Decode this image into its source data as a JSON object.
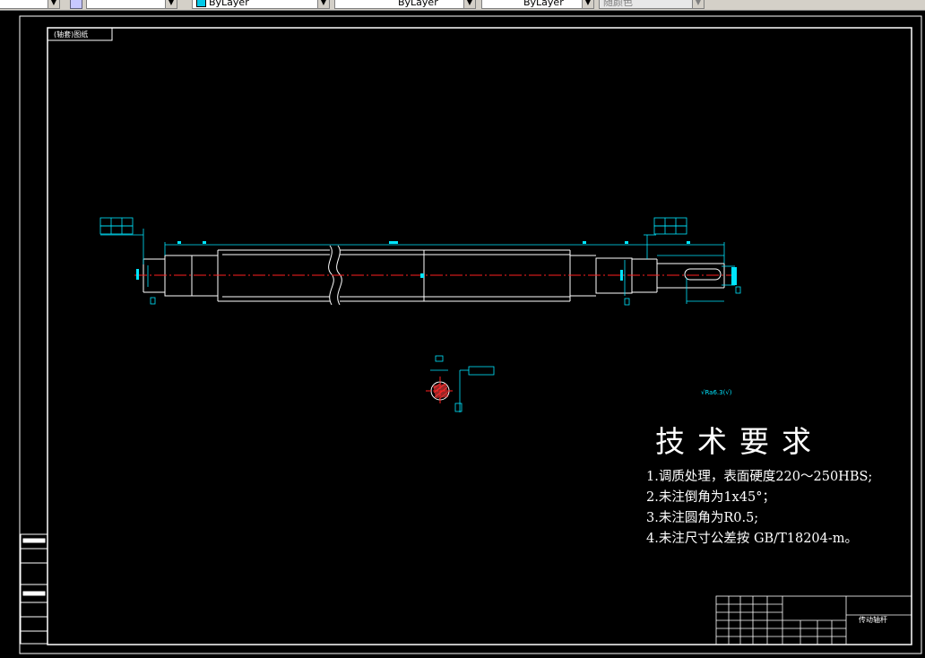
{
  "toolbar": {
    "layer_combo": "",
    "color_combo": "ByLayer",
    "linetype_combo": "ByLayer",
    "lineweight_combo": "ByLayer",
    "plotstyle_combo": "随颜色"
  },
  "drawing": {
    "frame_label": "(轴套)图纸",
    "roughness_symbol": "√Ra6.3(√)",
    "notes_title": "技术要求",
    "notes": [
      "1.调质处理，表面硬度220～250HBS;",
      "2.未注倒角为1x45°；",
      "3.未注圆角为R0.5;",
      "4.未注尺寸公差按 GB/T18204-m。"
    ],
    "title_block_name": "传动轴杆"
  },
  "colors": {
    "background": "#000000",
    "frame": "#ffffff",
    "geometry": "#ffffff",
    "dimension": "#00e5ff",
    "centerline": "#ff2020"
  }
}
